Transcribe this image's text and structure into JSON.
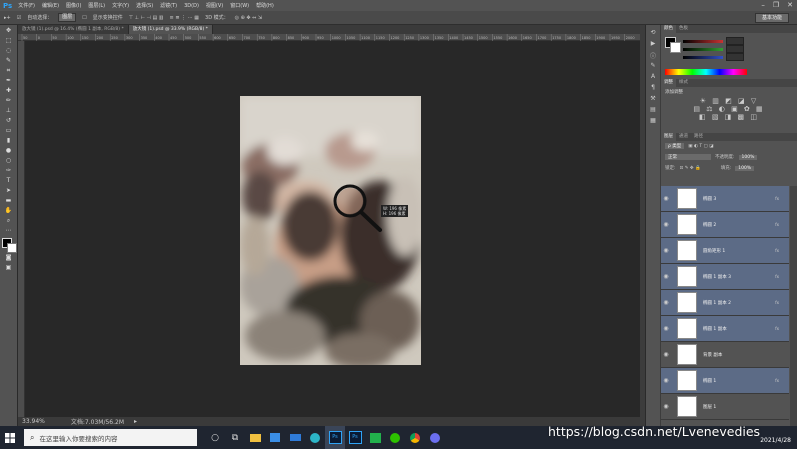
{
  "menu": {
    "logo": "Ps",
    "items": [
      "文件(F)",
      "编辑(E)",
      "图像(I)",
      "图层(L)",
      "文字(Y)",
      "选择(S)",
      "滤镜(T)",
      "3D(D)",
      "视图(V)",
      "窗口(W)",
      "帮助(H)"
    ]
  },
  "options": {
    "auto_select": "自动选择：",
    "group": "图层",
    "show_transform": "显示变换控件",
    "mode3d": "3D 模式：",
    "workspace": "基本功能"
  },
  "tabs": [
    {
      "label": "放大镜 (1).psd @ 16.4% (椭圆 1 副本, RGB/8) *",
      "active": false
    },
    {
      "label": "放大镜 (1).psd @ 33.9% (RGB/8) *",
      "active": true
    }
  ],
  "ruler_marks": [
    "50",
    "0",
    "50",
    "100",
    "150",
    "200",
    "250",
    "300",
    "350",
    "400",
    "450",
    "500",
    "550",
    "600",
    "650",
    "700",
    "750",
    "800",
    "850",
    "900",
    "950",
    "1000",
    "1050",
    "1100",
    "1150",
    "1200",
    "1250",
    "1300",
    "1350",
    "1400",
    "1450",
    "1500",
    "1550",
    "1600",
    "1650",
    "1700",
    "1750",
    "1800",
    "1850",
    "1900",
    "1950",
    "2000"
  ],
  "magnifier_info": {
    "w": "W: 196 像素",
    "h": "H: 196 像素"
  },
  "status": {
    "zoom": "33.94%",
    "doc": "文档:7.03M/56.2M"
  },
  "color_panel": {
    "tabs": [
      "颜色",
      "色板"
    ],
    "colors": {
      "red": "#c83232",
      "green": "#32a032",
      "blue": "#3250c8"
    }
  },
  "adjust_panel": {
    "tabs": [
      "调整",
      "样式"
    ],
    "title": "添加调整"
  },
  "layers_panel": {
    "tabs": [
      "图层",
      "通道",
      "路径"
    ],
    "kind": "ρ 类型",
    "blend": "正常",
    "opacity_label": "不透明度:",
    "opacity": "100%",
    "lock_label": "锁定:",
    "fill_label": "填充:",
    "fill": "100%",
    "layers": [
      {
        "name": "椭圆 3",
        "fx": "fx",
        "style": "normal"
      },
      {
        "name": "椭圆 2",
        "fx": "fx",
        "style": "normal"
      },
      {
        "name": "圆角矩形 1",
        "fx": "fx",
        "style": "normal"
      },
      {
        "name": "椭圆 1 副本 3",
        "fx": "fx",
        "style": "normal"
      },
      {
        "name": "椭圆 1 副本 2",
        "fx": "fx",
        "style": "normal"
      },
      {
        "name": "椭圆 1 副本",
        "fx": "fx",
        "style": "normal"
      },
      {
        "name": "背景 副本",
        "fx": "",
        "style": "plain"
      },
      {
        "name": "椭圆 1",
        "fx": "fx",
        "style": "normal"
      },
      {
        "name": "图层 1",
        "fx": "",
        "style": "plain"
      }
    ]
  },
  "taskbar": {
    "search_placeholder": "在这里输入你要搜索的内容",
    "date": "2021/4/28"
  },
  "watermark": "https://blog.csdn.net/Lvenevedies"
}
